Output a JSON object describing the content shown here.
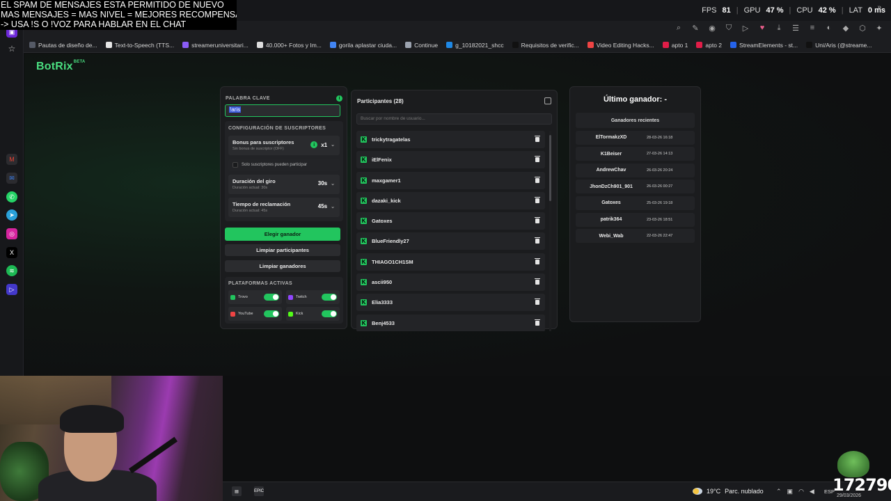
{
  "overlay": {
    "line1": "EL SPAM DE MENSAJES ESTA PERMITIDO DE NUEVO",
    "line2": "MAS MENSAJES = MAS NIVEL = MEJORES RECOMPENSAS",
    "line3": "-> USA !S  O !VOZ PARA HABLAR EN EL CHAT"
  },
  "perf": {
    "fps_label": "FPS",
    "fps": "81",
    "gpu_label": "GPU",
    "gpu": "47 %",
    "cpu_label": "CPU",
    "cpu": "42 %",
    "lat_label": "LAT",
    "lat": "0 ms"
  },
  "bookmarks": [
    {
      "label": "Pautas de diseño de...",
      "color": "#555a66"
    },
    {
      "label": "Text-to-Speech (TTS...",
      "color": "#e5e5e5"
    },
    {
      "label": "streameruniversitari...",
      "color": "#8b5cf6"
    },
    {
      "label": "40.000+ Fotos y Im...",
      "color": "#dddddd"
    },
    {
      "label": "gorila aplastar ciuda...",
      "color": "#4285f4"
    },
    {
      "label": "Continue",
      "color": "#9ca3af"
    },
    {
      "label": "g_10182021_shcc",
      "color": "#1e88e5"
    },
    {
      "label": "Requisitos de verific...",
      "color": "#111111"
    },
    {
      "label": "Video Editing Hacks...",
      "color": "#ef4444"
    },
    {
      "label": "apto 1",
      "color": "#e11d48"
    },
    {
      "label": "apto 2",
      "color": "#e11d48"
    },
    {
      "label": "StreamElements - st...",
      "color": "#2563eb"
    },
    {
      "label": "Uni/Aris (@streame...",
      "color": "#111111"
    }
  ],
  "logo": {
    "name": "BotRix",
    "badge": "BETA"
  },
  "config": {
    "keyword_label": "PALABRA CLAVE",
    "keyword_value": "!aris",
    "subs_section": "CONFIGURACIÓN DE SUSCRIPTORES",
    "bonus_title": "Bonus para suscriptores",
    "bonus_sub": "Sin bonus de suscriptor (OFF)",
    "bonus_value": "x1",
    "only_subs": "Solo suscriptores pueden participar",
    "spin_title": "Duración del giro",
    "spin_sub": "Duración actual: 30s",
    "spin_value": "30s",
    "claim_title": "Tiempo de reclamación",
    "claim_sub": "Duración actual: 45s",
    "claim_value": "45s",
    "pick_winner": "Elegir ganador",
    "clear_participants": "Limpiar participantes",
    "clear_winners": "Limpiar ganadores",
    "platforms_label": "PLATAFORMAS ACTIVAS",
    "platforms": [
      {
        "name": "Trovo",
        "color": "#22c55e",
        "enabled": true
      },
      {
        "name": "Twitch",
        "color": "#9146ff",
        "enabled": true
      },
      {
        "name": "YouTube",
        "color": "#ef4444",
        "enabled": true
      },
      {
        "name": "Kick",
        "color": "#53fc18",
        "enabled": true
      }
    ]
  },
  "participants": {
    "title": "Participantes (28)",
    "search_placeholder": "Buscar por nombre de usuario...",
    "items": [
      "trickytragatelas",
      "iElFenix",
      "maxgamer1",
      "dazaki_kick",
      "Gatoxes",
      "BlueFriendly27",
      "THIAGO1CH1SM",
      "ascii950",
      "Elia3333",
      "Benj4533"
    ]
  },
  "winners": {
    "last_winner": "Último ganador: -",
    "recent_label": "Ganadores recientes",
    "items": [
      {
        "name": "ElTormakzXD",
        "date": "28-03-26 16:18"
      },
      {
        "name": "K1Beiser",
        "date": "27-03-26 14:13"
      },
      {
        "name": "AndrewChav",
        "date": "26-03-26 20:24"
      },
      {
        "name": "JhonDzCh901_901",
        "date": "26-03-26 00:27"
      },
      {
        "name": "Gatoxes",
        "date": "25-03-26 19:18"
      },
      {
        "name": "patrik364",
        "date": "23-03-26 18:51"
      },
      {
        "name": "Webi_Wab",
        "date": "22-03-26 22:47"
      }
    ]
  },
  "taskbar": {
    "temp": "19°C",
    "weather": "Parc. nublado",
    "lang": "ESP",
    "epic_label": "EPIC",
    "date": "29/03/2026"
  },
  "counter": "172790"
}
